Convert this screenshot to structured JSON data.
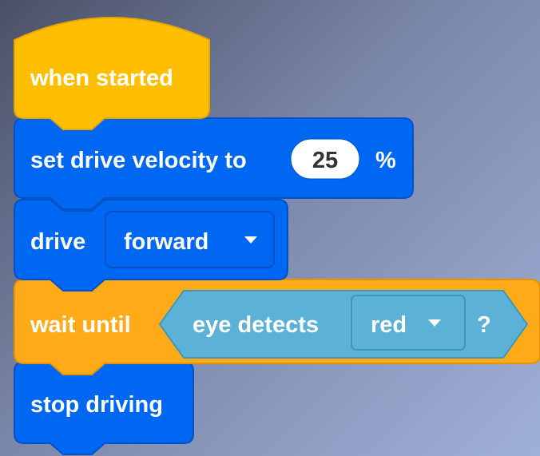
{
  "colors": {
    "events_block": "#ffbf00",
    "events_border": "#e6a600",
    "motion_block": "#0067f3",
    "motion_border": "#0052c9",
    "control_block": "#ffab19",
    "sensing_block": "#5cb1d6",
    "sensing_border": "#3e97bd"
  },
  "script": {
    "hat_block": {
      "label": "when started"
    },
    "set_velocity_block": {
      "label": "set drive velocity to",
      "value": "25",
      "unit": "%"
    },
    "drive_block": {
      "label": "drive",
      "direction": "forward",
      "dropdown_icon": "triangle-down"
    },
    "wait_until_block": {
      "label": "wait until",
      "condition": {
        "label": "eye detects",
        "color_option": "red",
        "dropdown_icon": "triangle-down",
        "suffix": "?"
      }
    },
    "stop_block": {
      "label": "stop driving"
    }
  }
}
